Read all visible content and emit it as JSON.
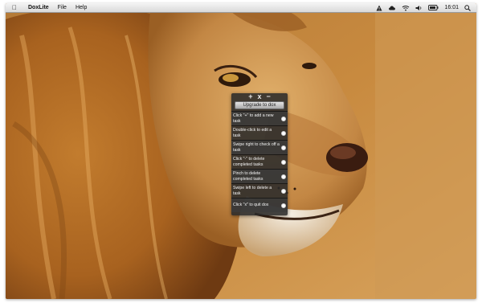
{
  "menubar": {
    "app_name": "DoxLite",
    "menus": [
      "File",
      "Help"
    ],
    "clock": "16:01",
    "tray_icons": [
      "alert-icon",
      "cloud-icon",
      "wifi-icon",
      "volume-icon",
      "battery-icon",
      "search-icon"
    ]
  },
  "popup": {
    "tools": [
      "+",
      "x",
      "−"
    ],
    "upgrade_label": "Upgrade to dox",
    "tasks": [
      "Click \"+\" to add a new task",
      "Double-click to edit a task",
      "Swipe right to check off a task",
      "Click \"-\" to delete completed tasks",
      "Pinch to delete completed tasks",
      "Swipe left to delete a task",
      "Click \"x\" to quit dox"
    ]
  },
  "colors": {
    "panel_bg": "#2a2a2a",
    "menubar_bg": "#e6e6e6"
  }
}
